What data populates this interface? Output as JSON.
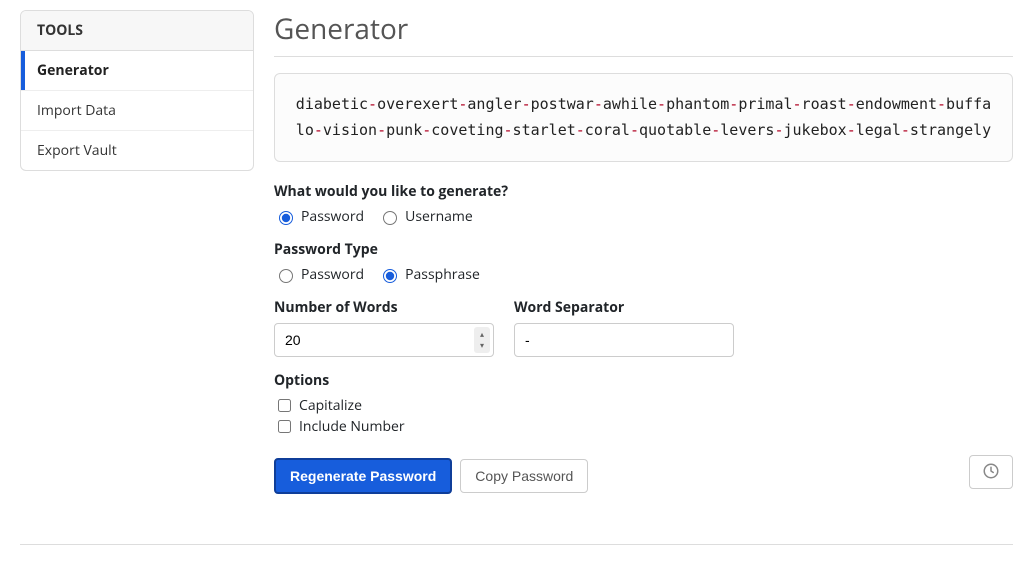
{
  "sidebar": {
    "header": "TOOLS",
    "items": [
      {
        "label": "Generator",
        "active": true
      },
      {
        "label": "Import Data",
        "active": false
      },
      {
        "label": "Export Vault",
        "active": false
      }
    ]
  },
  "page_title": "Generator",
  "generated": {
    "words": [
      "diabetic",
      "overexert",
      "angler",
      "postwar",
      "awhile",
      "phantom",
      "primal",
      "roast",
      "endowment",
      "buffalo",
      "vision",
      "punk",
      "coveting",
      "starlet",
      "coral",
      "quotable",
      "levers",
      "jukebox",
      "legal",
      "strangely"
    ],
    "separator": "-"
  },
  "labels": {
    "what_generate": "What would you like to generate?",
    "password_type": "Password Type",
    "num_words": "Number of Words",
    "word_sep": "Word Separator",
    "options": "Options"
  },
  "radios": {
    "gen_password": "Password",
    "gen_username": "Username",
    "type_password": "Password",
    "type_passphrase": "Passphrase"
  },
  "fields": {
    "num_words_value": "20",
    "word_sep_value": "-"
  },
  "checkboxes": {
    "capitalize": "Capitalize",
    "include_number": "Include Number"
  },
  "buttons": {
    "regenerate": "Regenerate Password",
    "copy": "Copy Password"
  }
}
